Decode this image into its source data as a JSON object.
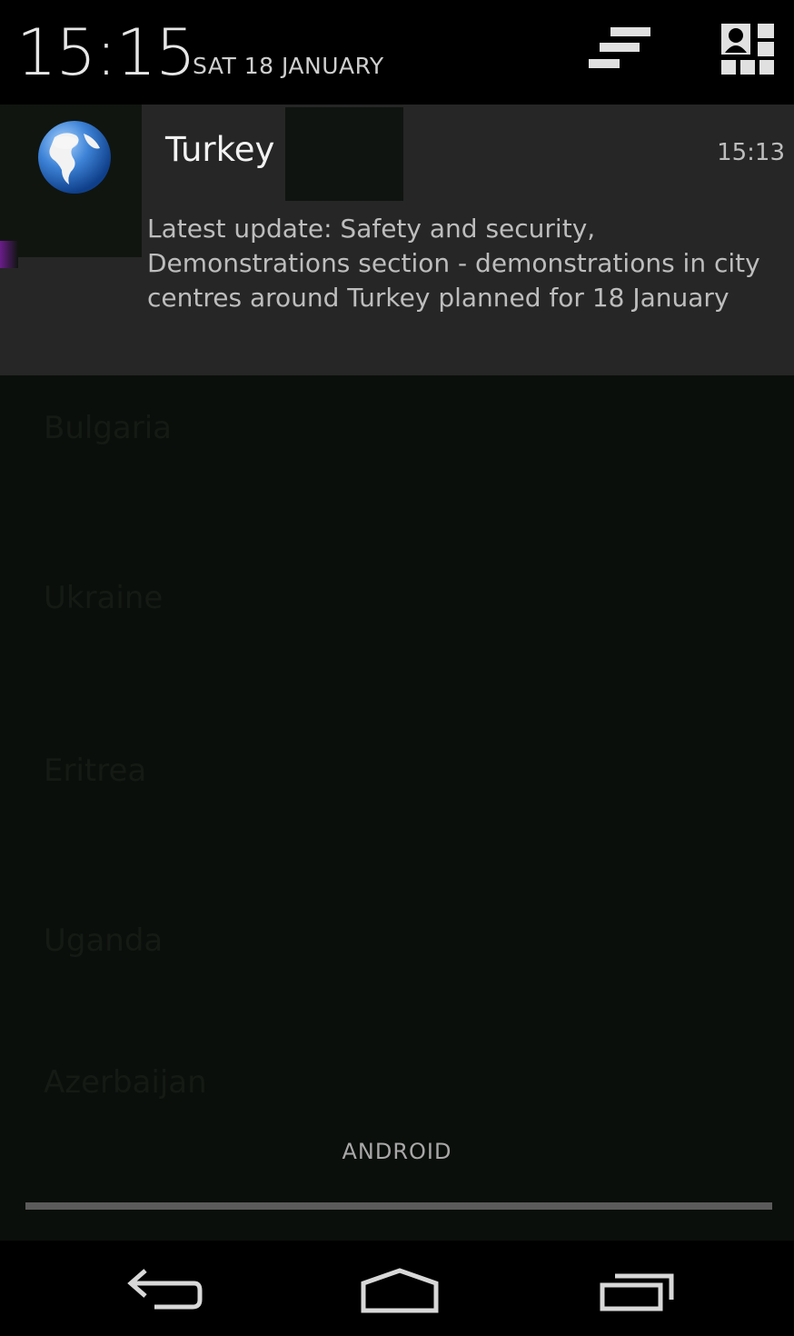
{
  "status": {
    "time": "15:15",
    "date": "SAT 18 JANUARY"
  },
  "header_icons": {
    "clear": "clear-all-icon",
    "quick_settings": "quick-settings-icon"
  },
  "notification": {
    "icon": "globe-icon",
    "title": "Turkey",
    "time": "15:13",
    "text": "Latest update: Safety and security, Demonstrations section - demonstrations in city centres around Turkey planned for 18 January"
  },
  "background_list": [
    "Bulgaria",
    "Ukraine",
    "Eritrea",
    "Uganda",
    "Azerbaijan"
  ],
  "carrier_label": "ANDROID",
  "navbar": {
    "back": "back-icon",
    "home": "home-icon",
    "recents": "recents-icon"
  },
  "colors": {
    "notification_bg": "#262626",
    "shade_bg": "#0b0f0b",
    "bar_bg": "#000000"
  }
}
